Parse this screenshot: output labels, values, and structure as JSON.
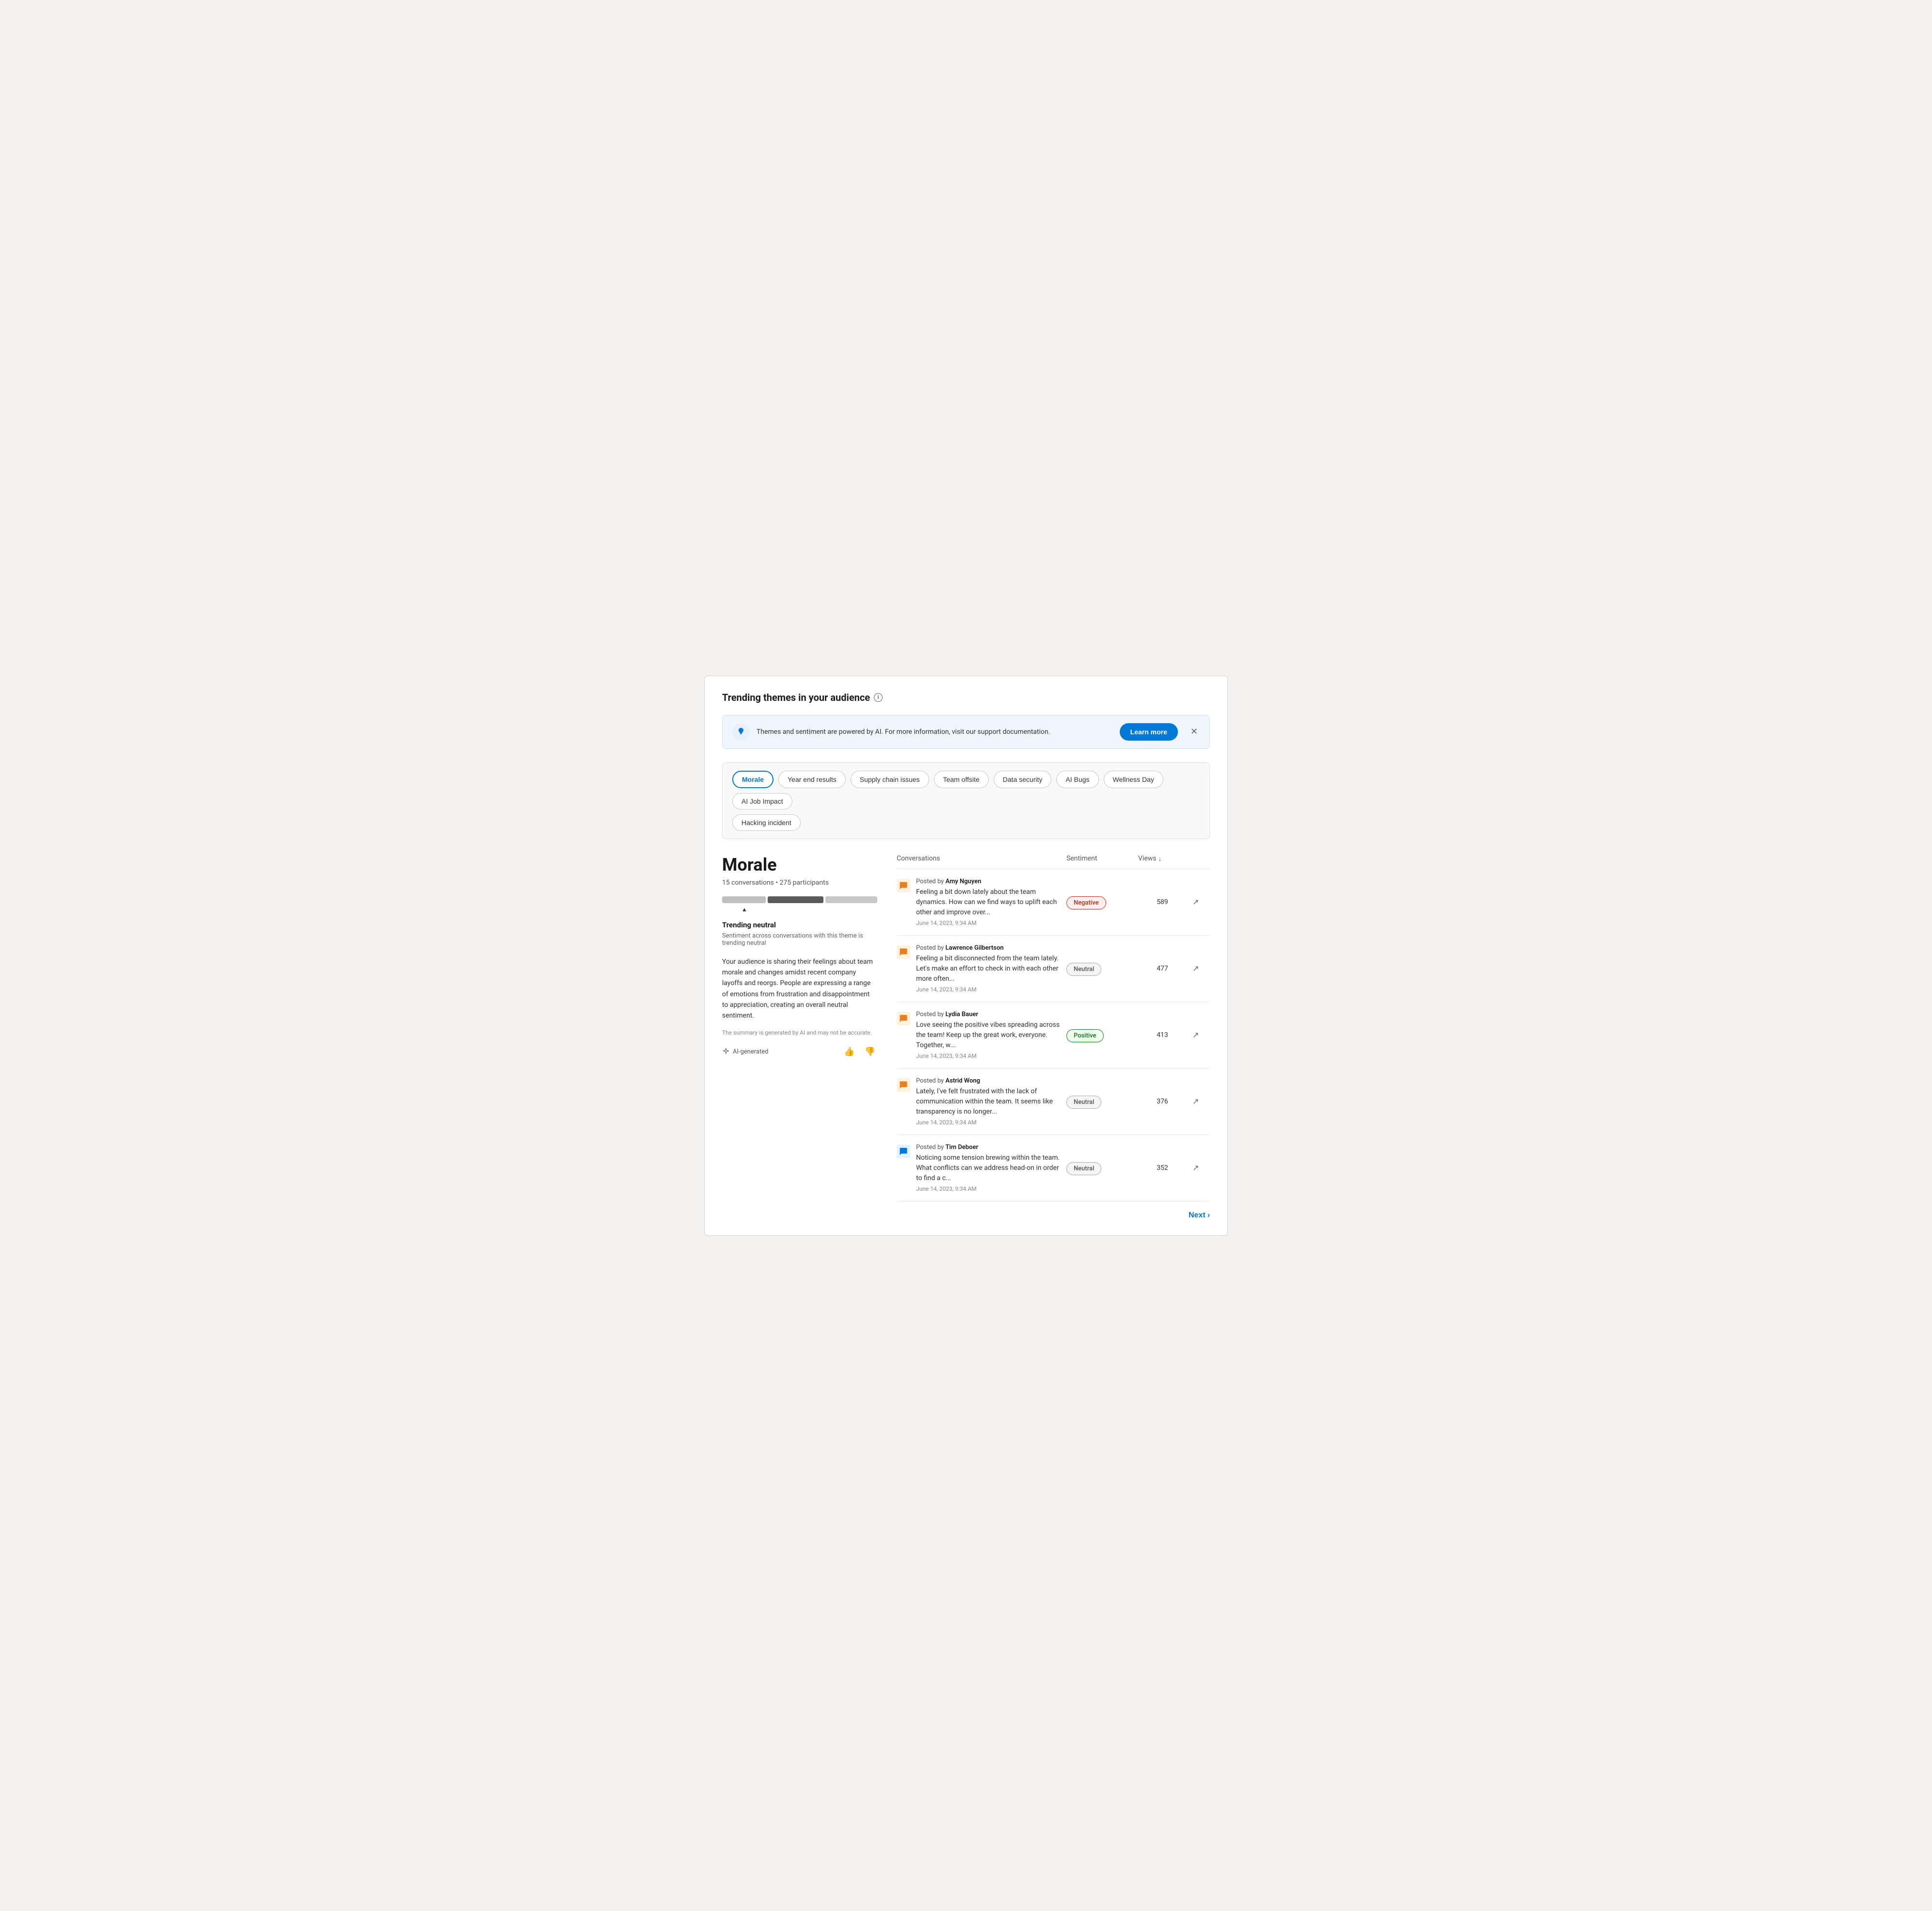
{
  "page": {
    "title": "Trending themes in your audience",
    "banner": {
      "text": "Themes and sentiment are powered by AI. For more information, visit our support documentation.",
      "learn_more": "Learn more"
    },
    "tabs": [
      {
        "id": "morale",
        "label": "Morale",
        "active": true
      },
      {
        "id": "year-end",
        "label": "Year end results",
        "active": false
      },
      {
        "id": "supply-chain",
        "label": "Supply chain issues",
        "active": false
      },
      {
        "id": "team-offsite",
        "label": "Team offsite",
        "active": false
      },
      {
        "id": "data-security",
        "label": "Data security",
        "active": false
      },
      {
        "id": "ai-bugs",
        "label": "AI Bugs",
        "active": false
      },
      {
        "id": "wellness-day",
        "label": "Wellness Day",
        "active": false
      },
      {
        "id": "ai-job-impact",
        "label": "AI Job Impact",
        "active": false
      },
      {
        "id": "hacking-incident",
        "label": "Hacking incident",
        "active": false
      }
    ],
    "topic": {
      "title": "Morale",
      "conversations_count": "15 conversations",
      "participants_count": "275 participants",
      "trending_label": "Trending neutral",
      "trending_sub": "Sentiment across conversations with this theme is trending neutral",
      "summary": "Your audience is sharing their feelings about team morale and changes amidst recent company layoffs and reorgs. People are expressing a range of emotions from frustration and disappointment to appreciation, creating an overall neutral sentiment.",
      "ai_disclaimer": "The summary is generated by AI and may not be accurate.",
      "ai_badge": "AI-generated"
    },
    "table": {
      "headers": [
        {
          "label": "Conversations",
          "sortable": false
        },
        {
          "label": "Sentiment",
          "sortable": false
        },
        {
          "label": "Views",
          "sortable": true,
          "sort_dir": "desc"
        },
        {
          "label": "",
          "sortable": false
        }
      ],
      "rows": [
        {
          "author": "Amy Nguyen",
          "text": "Feeling a bit down lately about the team dynamics. How can we find ways to uplift each other and improve over...",
          "date": "June 14, 2023, 9:34 AM",
          "sentiment": "Negative",
          "sentiment_class": "negative",
          "views": "589",
          "icon_color": "orange"
        },
        {
          "author": "Lawrence Gilbertson",
          "text": "Feeling a bit disconnected from the team lately. Let's make an effort to check in with each other more often...",
          "date": "June 14, 2023, 9:34 AM",
          "sentiment": "Neutral",
          "sentiment_class": "neutral",
          "views": "477",
          "icon_color": "orange"
        },
        {
          "author": "Lydia Bauer",
          "text": "Love seeing the positive vibes spreading across the team! Keep up the great work, everyone. Together, w...",
          "date": "June 14, 2023, 9:34 AM",
          "sentiment": "Positive",
          "sentiment_class": "positive",
          "views": "413",
          "icon_color": "orange"
        },
        {
          "author": "Astrid Wong",
          "text": "Lately, I've felt frustrated with the lack of communication within the team. It seems like transparency is no longer...",
          "date": "June 14, 2023, 9:34 AM",
          "sentiment": "Neutral",
          "sentiment_class": "neutral",
          "views": "376",
          "icon_color": "orange"
        },
        {
          "author": "Tim Deboer",
          "text": "Noticing some tension brewing within the team. What conflicts can we address head-on in order to find a c...",
          "date": "June 14, 2023, 9:34 AM",
          "sentiment": "Neutral",
          "sentiment_class": "neutral",
          "views": "352",
          "icon_color": "blue"
        }
      ]
    },
    "pagination": {
      "next_label": "Next"
    }
  }
}
